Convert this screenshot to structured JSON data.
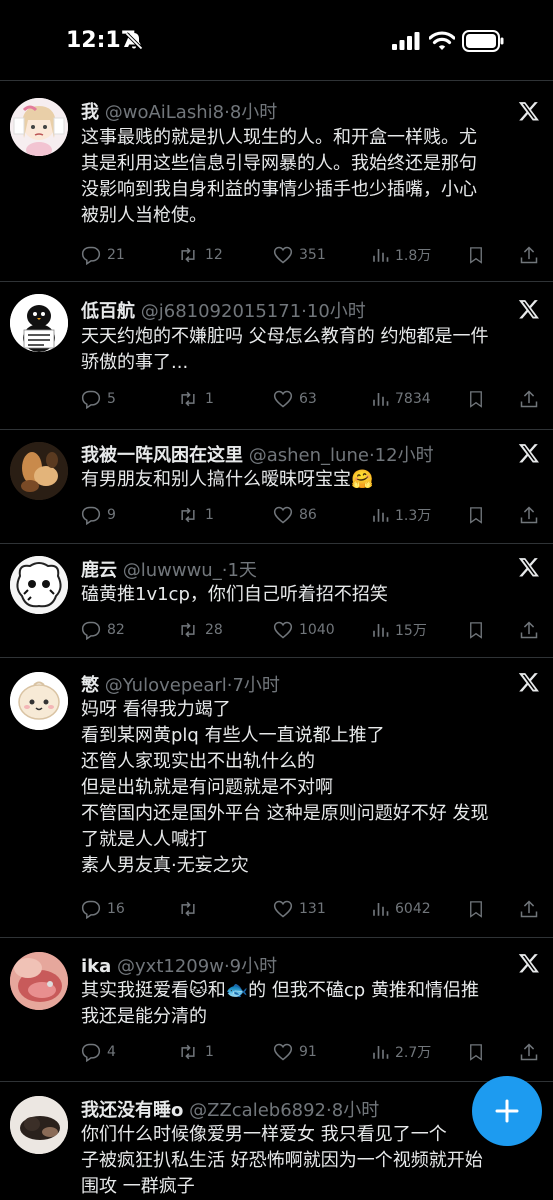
{
  "status": {
    "time": "12:17"
  },
  "tweets": [
    {
      "name": "我",
      "handle": "@woAiLashi8",
      "time": "8小时",
      "lines": [
        "这事最贱的就是扒人现生的人。和开盒一样贱。尤",
        "其是利用这些信息引导网暴的人。我始终还是那句",
        "没影响到我自身利益的事情少插手也少插嘴，小心",
        "被别人当枪使。"
      ],
      "replies": "21",
      "retweets": "12",
      "likes": "351",
      "views": "1.8万"
    },
    {
      "name": "低百航",
      "handle": "@j681092015171",
      "time": "10小时",
      "lines": [
        "天天约炮的不嫌脏吗 父母怎么教育的 约炮都是一件",
        "骄傲的事了..."
      ],
      "replies": "5",
      "retweets": "1",
      "likes": "63",
      "views": "7834"
    },
    {
      "name": "我被一阵风困在这里",
      "handle": "@ashen_lune",
      "time": "12小时",
      "lines": [
        "有男朋友和别人搞什么暧昧呀宝宝🤗"
      ],
      "replies": "9",
      "retweets": "1",
      "likes": "86",
      "views": "1.3万"
    },
    {
      "name": "鹿云",
      "handle": "@luwwwu_",
      "time": "1天",
      "lines": [
        "磕黄推1v1cp，你们自己听着招不招笑"
      ],
      "replies": "82",
      "retweets": "28",
      "likes": "1040",
      "views": "15万"
    },
    {
      "name": "慜",
      "handle": "@Yulovepearl",
      "time": "7小时",
      "lines": [
        "妈呀 看得我力竭了",
        "看到某网黄plq 有些人一直说都上推了",
        "还管人家现实出不出轨什么的",
        "但是出轨就是有问题就是不对啊",
        "不管国内还是国外平台 这种是原则问题好不好 发现",
        "了就是人人喊打",
        "素人男友真·无妄之灾"
      ],
      "replies": "16",
      "retweets": "",
      "likes": "131",
      "views": "6042"
    },
    {
      "name": "ika",
      "handle": "@yxt1209w",
      "time": "9小时",
      "lines": [
        "其实我挺爱看🐱和🐟的 但我不磕cp 黄推和情侣推",
        "我还是能分清的"
      ],
      "replies": "4",
      "retweets": "1",
      "likes": "91",
      "views": "2.7万"
    },
    {
      "name": "我还没有睡o",
      "handle": "@ZZcaleb6892",
      "time": "8小时",
      "lines": [
        "你们什么时候像爱男一样爱女 我只看见了一个",
        "子被疯狂扒私生活 好恐怖啊就因为一个视频就开始",
        "围攻 一群疯子"
      ],
      "replies": "",
      "retweets": "",
      "likes": "",
      "views": ""
    }
  ],
  "colors": {
    "accent": "#1d9bf0",
    "text": "#e7e9ea",
    "muted": "#71767b",
    "divider": "#2f3336"
  }
}
